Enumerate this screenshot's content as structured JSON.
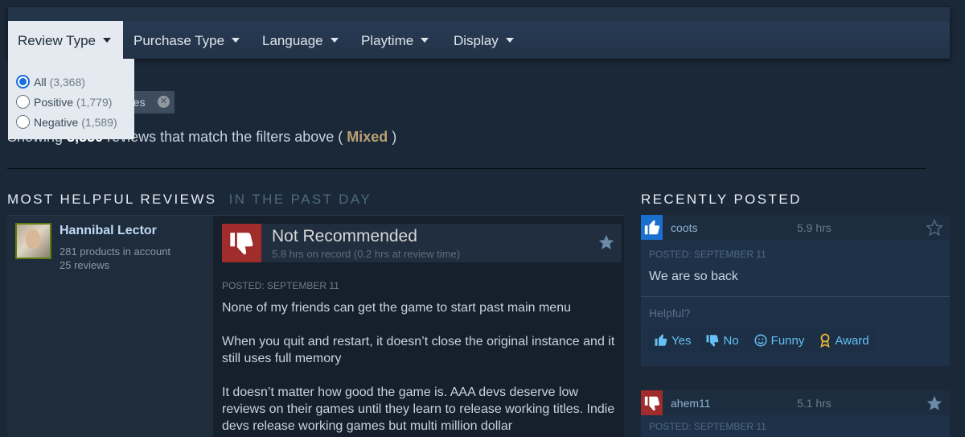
{
  "filters": {
    "tabs": [
      {
        "label": "Review Type"
      },
      {
        "label": "Purchase Type"
      },
      {
        "label": "Language"
      },
      {
        "label": "Playtime"
      },
      {
        "label": "Display"
      }
    ],
    "review_type_options": [
      {
        "label": "All",
        "count": "(3,368)",
        "checked": true
      },
      {
        "label": "Positive",
        "count": "(1,779)",
        "checked": false
      },
      {
        "label": "Negative",
        "count": "(1,589)",
        "checked": false
      }
    ],
    "chip_label": "ges"
  },
  "summary": {
    "prefix": "Showing",
    "count": "3,330",
    "middle": "reviews that match the filters above (",
    "rating": "Mixed",
    "suffix": ")"
  },
  "sections": {
    "helpful_title": "MOST HELPFUL REVIEWS",
    "helpful_period": "IN THE PAST DAY",
    "recent_title": "RECENTLY POSTED"
  },
  "review": {
    "author": "Hannibal Lector",
    "products": "281 products in account",
    "reviews": "25 reviews",
    "verdict": "Not Recommended",
    "hours": "5.8 hrs on record (0.2 hrs at review time)",
    "posted": "POSTED: SEPTEMBER 11",
    "paragraphs": [
      "None of my friends can get the game to start past main menu",
      "When you quit and restart, it doesn’t close the original instance and it still uses full memory",
      "It doesn’t matter how good the game is. AAA devs deserve low reviews on their games until they learn to release working titles. Indie devs release working games but multi million dollar"
    ]
  },
  "recent": [
    {
      "name": "coots",
      "hours": "5.9 hrs",
      "recommended": true,
      "posted": "POSTED: SEPTEMBER 11",
      "text": "We are so back",
      "helpful_label": "Helpful?",
      "actions": [
        "Yes",
        "No",
        "Funny",
        "Award"
      ]
    },
    {
      "name": "ahem11",
      "hours": "5.1 hrs",
      "recommended": false,
      "posted": "POSTED: SEPTEMBER 11"
    }
  ],
  "colors": {
    "background": "#1b2838",
    "rating_mixed": "#b9a074",
    "thumb_down": "#a02c2c",
    "thumb_up": "#1a6fcf",
    "link": "#66c0f4"
  },
  "icons": {
    "thumbs_down": "thumbs-down-icon",
    "thumbs_up": "thumbs-up-icon",
    "star": "star-icon",
    "funny": "smiley-icon",
    "award": "award-icon",
    "remove": "close-icon"
  }
}
